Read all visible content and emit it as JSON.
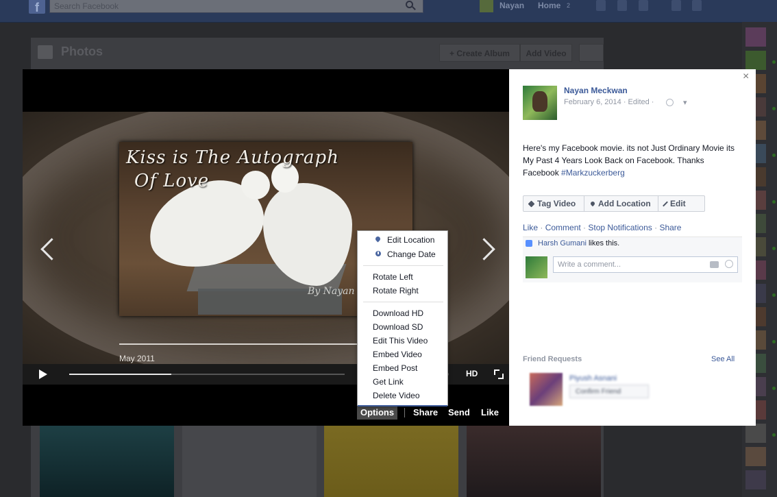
{
  "topbar": {
    "search_placeholder": "Search Facebook",
    "user_name": "Nayan",
    "home_label": "Home",
    "home_count": "2"
  },
  "page": {
    "title": "Photos",
    "create_album": "+ Create Album",
    "add_video": "Add Video"
  },
  "viewer": {
    "photo_title_line1": "Kiss is The Autograph",
    "photo_title_line2": "Of Love",
    "watermark": "By Nayan",
    "video_date": "May 2011",
    "seek_played_fraction": 0.37,
    "hd_label": "HD",
    "volume_fragment": ")",
    "actions": {
      "options": "Options",
      "share": "Share",
      "send": "Send",
      "like": "Like"
    }
  },
  "options_menu": {
    "items": [
      "Edit Location",
      "Change Date",
      "Rotate Left",
      "Rotate Right",
      "Download HD",
      "Download SD",
      "Edit This Video",
      "Embed Video",
      "Embed Post",
      "Get Link",
      "Delete Video"
    ]
  },
  "panel": {
    "close": "×",
    "author": "Nayan Meckwan",
    "meta": "February 6, 2014 · Edited ·",
    "privacy": "▾",
    "post_text": "Here's my Facebook movie. its not Just Ordinary Movie its My Past 4 Years Look Back on Facebook. Thanks Facebook ",
    "hashtag": "#Markzuckerberg",
    "buttons": {
      "tag_video": "Tag Video",
      "add_location": "Add Location",
      "edit": "Edit"
    },
    "ufi": {
      "like": "Like",
      "comment": "Comment",
      "stop_notifications": "Stop Notifications",
      "share": "Share",
      "sep": " · "
    },
    "likes": {
      "liker": "Harsh Gumani",
      "suffix": " likes this."
    },
    "comment_placeholder": "Write a comment...",
    "friend_requests": {
      "title": "Friend Requests",
      "see_all": "See All",
      "name": "Piyush Asnani",
      "confirm": "Confirm Friend"
    }
  }
}
